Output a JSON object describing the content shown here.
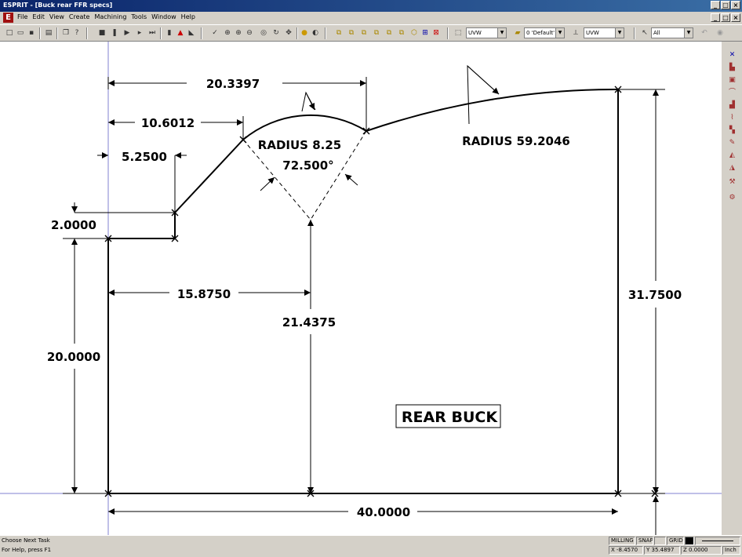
{
  "window": {
    "title": "ESPRIT - [Buck rear FFR specs]",
    "minimize": "_",
    "maximize": "□",
    "close": "×"
  },
  "menu": {
    "app_logo": "E",
    "items": [
      "File",
      "Edit",
      "View",
      "Create",
      "Machining",
      "Tools",
      "Window",
      "Help"
    ]
  },
  "toolbar": {
    "workplane_select": "UVW",
    "layer_select": "0 'Default'",
    "view_select": "UVW",
    "filter_select": "All"
  },
  "drawing": {
    "dimensions": {
      "top_width": "20.3397",
      "arc_start": "10.6012",
      "step_x": "5.2500",
      "step_y": "2.0000",
      "arc_center_x": "15.8750",
      "arc_center_y": "21.4375",
      "left_height": "20.0000",
      "right_height": "31.7500",
      "bottom_width": "40.0000"
    },
    "radius_small": "RADIUS  8.25",
    "angle": "72.500°",
    "radius_large": "RADIUS  59.2046",
    "part_label": "REAR BUCK"
  },
  "status": {
    "prompt": "Choose Next Task",
    "help": "For Help, press F1",
    "mode": "MILLING",
    "snap": "SNAP",
    "grid": "GRID",
    "x": "X -8.4570",
    "y": "Y 35.4897",
    "z": "Z 0.0000",
    "units": "Inch"
  }
}
